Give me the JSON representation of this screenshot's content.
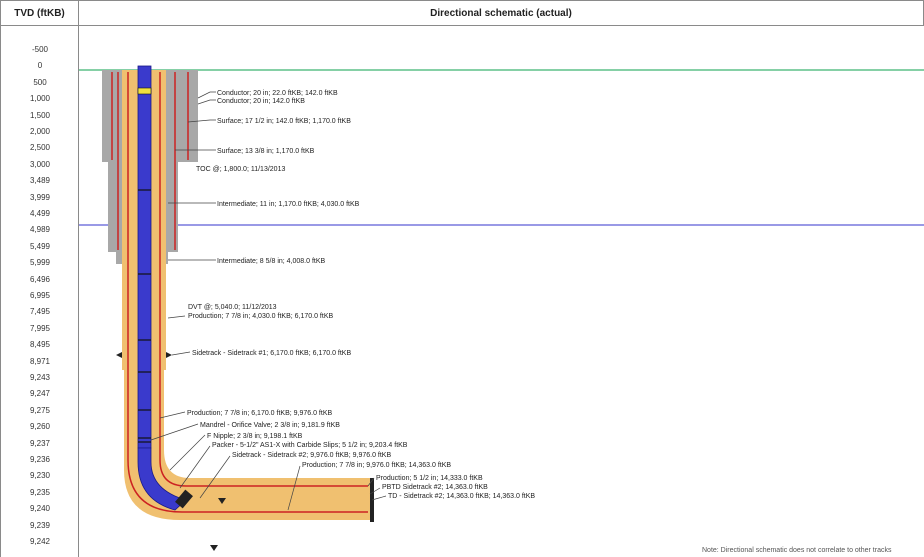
{
  "header": {
    "tvd_label": "TVD (ftKB)",
    "schematic_title": "Directional schematic (actual)"
  },
  "tvd_ticks": [
    "-500",
    "0",
    "500",
    "1,000",
    "1,500",
    "2,000",
    "2,500",
    "3,000",
    "3,489",
    "3,999",
    "4,499",
    "4,989",
    "5,499",
    "5,999",
    "6,496",
    "6,995",
    "7,495",
    "7,995",
    "8,495",
    "8,971",
    "9,243",
    "9,247",
    "9,275",
    "9,260",
    "9,237",
    "9,236",
    "9,230",
    "9,235",
    "9,240",
    "9,239",
    "9,242"
  ],
  "annotations": [
    "Conductor; 20 in; 22.0 ftKB; 142.0 ftKB",
    "Conductor; 20 in; 142.0 ftKB",
    "Surface; 17 1/2 in; 142.0 ftKB; 1,170.0 ftKB",
    "Surface; 13 3/8 in; 1,170.0 ftKB",
    "TOC @; 1,800.0; 11/13/2013",
    "Intermediate; 11 in; 1,170.0 ftKB; 4,030.0 ftKB",
    "Intermediate; 8 5/8 in; 4,008.0 ftKB",
    "DVT @; 5,040.0; 11/12/2013",
    "Production; 7 7/8 in; 4,030.0 ftKB; 6,170.0 ftKB",
    "Sidetrack - Sidetrack #1; 6,170.0 ftKB; 6,170.0 ftKB",
    "Production; 7 7/8 in; 6,170.0 ftKB; 9,976.0 ftKB",
    "Mandrel - Orifice Valve; 2 3/8 in; 9,181.9 ftKB",
    "F Nipple; 2 3/8 in; 9,198.1 ftKB",
    "Packer - 5-1/2\" AS1-X with Carbide Slips; 5 1/2 in; 9,203.4 ftKB",
    "Sidetrack - Sidetrack #2; 9,976.0 ftKB; 9,976.0 ftKB",
    "Production; 7 7/8 in; 9,976.0 ftKB; 14,363.0 ftKB",
    "Production; 5 1/2 in; 14,333.0 ftKB",
    "PBTD Sidetrack #2; 14,363.0 ftKB",
    "TD - Sidetrack #2; 14,363.0 ftKB; 14,363.0 ftKB"
  ],
  "note": "Note: Directional schematic does not correlate to other tracks",
  "colors": {
    "ground_line": "#3cb371",
    "reference_line": "#3333cc",
    "cement": "#f0c070",
    "tubing": "#3a3acc",
    "casing_red": "#cc2222",
    "formation": "#a8a8a8"
  }
}
